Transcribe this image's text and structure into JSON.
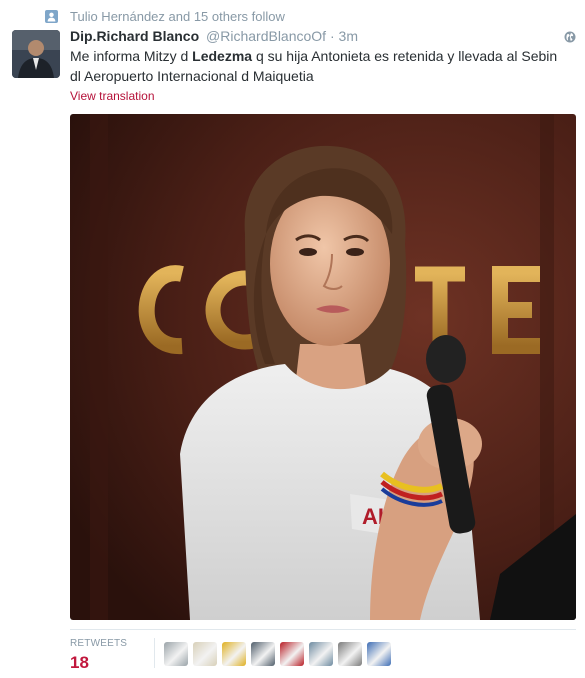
{
  "context": {
    "icon": "person-follow-icon",
    "text": "Tulio Hernández and 15 others follow"
  },
  "author": {
    "fullname": "Dip.Richard Blanco",
    "username": "@RichardBlancoOf",
    "separator": "·",
    "timestamp": "3m",
    "avatar_icon": "user-avatar"
  },
  "tweet": {
    "text_before": "Me informa Mitzy d ",
    "text_bold": "Ledezma",
    "text_after": " q su hija Antonieta es retenida y llevada al Sebin dl Aeropuerto Internacional d Maiquetia",
    "translate_label": "View translation",
    "privacy_icon": "globe-icon"
  },
  "media": {
    "type": "photo",
    "sign_letters": [
      "C",
      "O",
      "T",
      "E"
    ],
    "shirt_text": "ALed"
  },
  "stats": {
    "retweets_label": "RETWEETS",
    "retweets_count": "18",
    "retweeter_avatars": [
      {
        "name": "retweeter-avatar-1",
        "color": "#9aa3a8"
      },
      {
        "name": "retweeter-avatar-2",
        "color": "#d8d0b8"
      },
      {
        "name": "retweeter-avatar-3",
        "color": "#e0b020"
      },
      {
        "name": "retweeter-avatar-4",
        "color": "#4f5d6a"
      },
      {
        "name": "retweeter-avatar-5",
        "color": "#b81c24"
      },
      {
        "name": "retweeter-avatar-6",
        "color": "#6d8aa0"
      },
      {
        "name": "retweeter-avatar-7",
        "color": "#7a7a7a"
      },
      {
        "name": "retweeter-avatar-8",
        "color": "#3d6db5"
      }
    ]
  },
  "colors": {
    "accent": "#c1173d",
    "link": "#b5123a",
    "muted": "#8899a6",
    "text": "#292f33"
  }
}
